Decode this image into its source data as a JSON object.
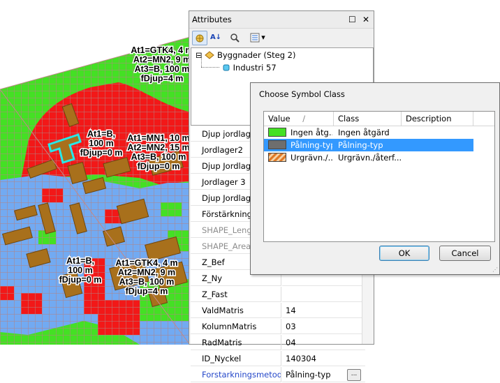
{
  "map": {
    "labels": [
      {
        "lines": [
          "At1=GTK4, 4 m",
          "At2=MN2, 9 m",
          "At3=B, 100 m",
          "fDjup=4 m"
        ]
      },
      {
        "lines": [
          "At1=B,",
          "100 m",
          "fDjup=0 m"
        ]
      },
      {
        "lines": [
          "At1=MN1, 10 m",
          "At2=MN2, 15 m",
          "At3=B, 100 m",
          "fDjup=0 m"
        ]
      },
      {
        "lines": [
          "At1=B,",
          "100 m",
          "fDjup=0 m"
        ]
      },
      {
        "lines": [
          "At1=GTK4, 4 m",
          "At2=MN2, 9 m",
          "At3=B, 100 m",
          "fDjup=4 m"
        ]
      }
    ],
    "colors": {
      "green": "#44e024",
      "red": "#f21818",
      "blue": "#72aaf2",
      "building": "#a8701c",
      "grid_line": "#b38383",
      "highlight": "#28e8e8"
    }
  },
  "attributes": {
    "title": "Attributes",
    "close_glyph": "✕",
    "dock_glyph": "☐",
    "toolbar": {
      "sort_label": "A↓",
      "dropdown_glyph": "▾"
    },
    "tree": {
      "expand_glyph": "⊟",
      "layer_name": "Byggnader (Steg 2)",
      "feature_name": "Industri 57"
    },
    "rows": [
      {
        "key": "Djup jordlage",
        "value": ""
      },
      {
        "key": "Jordlager2",
        "value": ""
      },
      {
        "key": "Djup Jordlage",
        "value": ""
      },
      {
        "key": "Jordlager 3",
        "value": ""
      },
      {
        "key": "Djup Jordlage",
        "value": ""
      },
      {
        "key": "Förstärknings",
        "value": ""
      },
      {
        "key": "SHAPE_Lengt",
        "value": ""
      },
      {
        "key": "SHAPE_Area",
        "value": ""
      },
      {
        "key": "Z_Bef",
        "value": ""
      },
      {
        "key": "Z_Ny",
        "value": ""
      },
      {
        "key": "Z_Fast",
        "value": ""
      },
      {
        "key": "ValdMatris",
        "value": "14"
      },
      {
        "key": "KolumnMatris",
        "value": "03"
      },
      {
        "key": "RadMatris",
        "value": "04"
      },
      {
        "key": "ID_Nyckel",
        "value": "140304"
      },
      {
        "key": "Forstarkningsmetod",
        "value": "Pålning-typ"
      }
    ],
    "ellipsis_label": "..."
  },
  "dialog": {
    "title": "Choose Symbol Class",
    "columns": {
      "value": "Value",
      "sort_glyph": "/",
      "class": "Class",
      "description": "Description"
    },
    "items": [
      {
        "value": "Ingen åtg...",
        "class": "Ingen åtgärd",
        "description": "",
        "swatch": "#44e024"
      },
      {
        "value": "Pålning-typ",
        "class": "Pålning-typ",
        "description": "",
        "swatch": "#6e6e6e"
      },
      {
        "value": "Urgrävn./...",
        "class": "Urgrävn./återf...",
        "description": "",
        "swatch": "#e07a28"
      }
    ],
    "ok_label": "OK",
    "cancel_label": "Cancel"
  }
}
